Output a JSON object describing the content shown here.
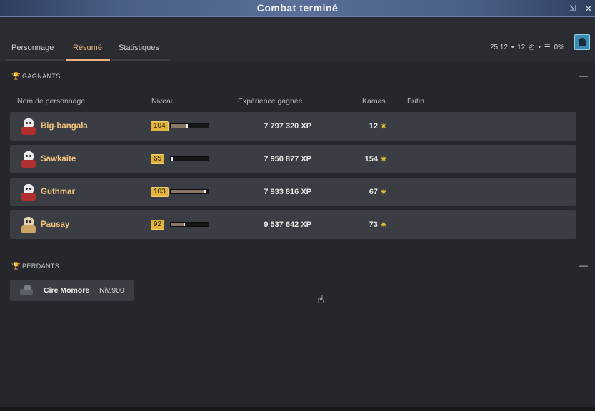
{
  "window": {
    "title": "Combat terminé"
  },
  "titlebar": {
    "shrink_icon": "shrink-icon",
    "close_icon": "close-icon",
    "shrink_glyph": "⇲",
    "close_glyph": "✕"
  },
  "tabs": [
    {
      "label": "Personnage",
      "active": false
    },
    {
      "label": "Résumé",
      "active": true
    },
    {
      "label": "Statistiques",
      "active": false
    }
  ],
  "status": {
    "time": "25:12",
    "sep1": "•",
    "turns": "12",
    "turns_icon": "◴",
    "sep2": "•",
    "percent_icon": "☰",
    "percent": "0%"
  },
  "winners": {
    "heading": "GAGNANTS",
    "collapse": "—",
    "columns": [
      "Nom de personnage",
      "Niveau",
      "Expérience gagnée",
      "Kamas",
      "Butin"
    ],
    "rows": [
      {
        "name": "Big-bangala",
        "level": "104",
        "level_progress": 0.45,
        "xp": "7 797 320 XP",
        "kamas": "12",
        "avatar": "skull-avatar"
      },
      {
        "name": "Sawkaite",
        "level": "65",
        "level_progress": 0.05,
        "xp": "7 950 877 XP",
        "kamas": "154",
        "avatar": "skull-avatar"
      },
      {
        "name": "Guthmar",
        "level": "103",
        "level_progress": 0.92,
        "xp": "7 933 816 XP",
        "kamas": "67",
        "avatar": "skull-avatar"
      },
      {
        "name": "Pausay",
        "level": "92",
        "level_progress": 0.38,
        "xp": "9 537 642 XP",
        "kamas": "73",
        "avatar": "hooded-avatar"
      }
    ]
  },
  "losers": {
    "heading": "PERDANTS",
    "collapse": "—",
    "rows": [
      {
        "name": "Cire Momore",
        "level": "Niv.900"
      }
    ]
  },
  "icons": {
    "trophy": "trophy-icon",
    "kama": "kama-icon",
    "kama_glyph": "✷",
    "trophy_glyph": "🏆"
  },
  "colors": {
    "accent": "#e9b27a",
    "name_gold": "#f1c27a",
    "kama_yellow": "#e8c12e",
    "level_badge": "#e0b33c"
  }
}
